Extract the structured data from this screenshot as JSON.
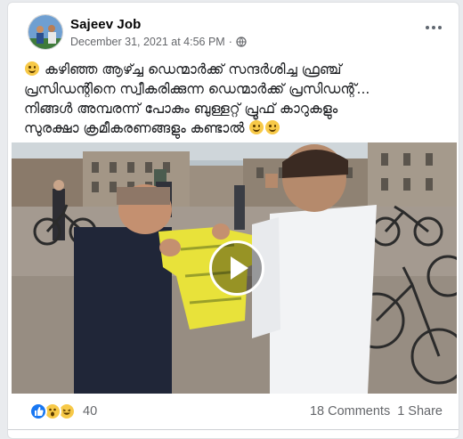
{
  "post": {
    "author": "Sajeev Job",
    "timestamp": "December 31, 2021 at 4:56 PM",
    "separator": "·",
    "privacy_icon": "globe-icon",
    "text_lines": [
      "കഴിഞ്ഞ ആഴ്ച്ച ഡെന്മാർക്ക് സന്ദർശിച്ച ഫ്രഞ്ച്",
      "പ്രസിഡന്റിനെ സ്വീകരിക്കുന്ന ഡെന്മാർക്ക് പ്രസിഡന്റ്...",
      "നിങ്ങൾ അമ്പരന്ന് പോകും ബുള്ളറ്റ് പ്രൂഫ് കാറുകളും",
      "സുരക്ഷാ ക്രമീകരണങ്ങളും കണ്ടാൽ"
    ]
  },
  "engagement": {
    "reaction_count": "40",
    "comments": "18 Comments",
    "shares": "1 Share"
  },
  "colors": {
    "meta_text": "#65676b",
    "like_blue": "#1877f2",
    "jersey_yellow": "#e8e23a"
  }
}
